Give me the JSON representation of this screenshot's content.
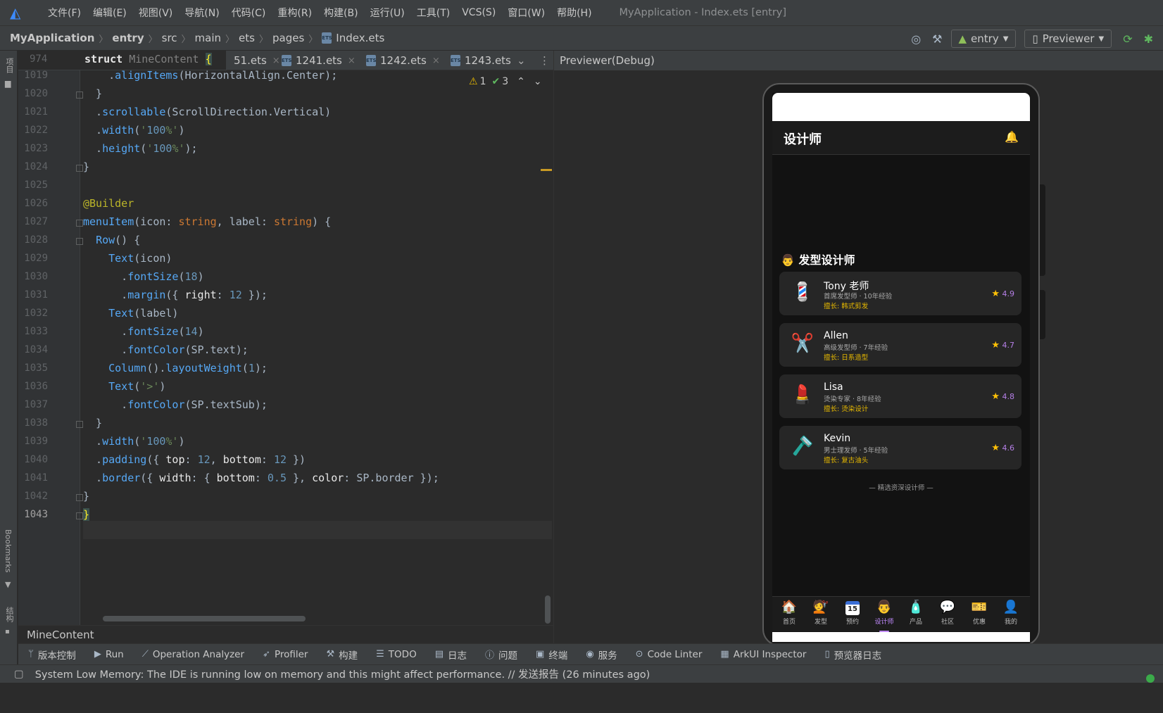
{
  "menubar": {
    "items": [
      "文件(F)",
      "编辑(E)",
      "视图(V)",
      "导航(N)",
      "代码(C)",
      "重构(R)",
      "构建(B)",
      "运行(U)",
      "工具(T)",
      "VCS(S)",
      "窗口(W)",
      "帮助(H)"
    ],
    "window_title": "MyApplication - Index.ets [entry]"
  },
  "navbar": {
    "crumbs": [
      "MyApplication",
      "entry",
      "src",
      "main",
      "ets",
      "pages"
    ],
    "file": "Index.ets",
    "run_config": "entry",
    "device": "Previewer"
  },
  "left_strip": {
    "project": "项目",
    "bookmarks": "Bookmarks",
    "structure": "结构"
  },
  "editor": {
    "sticky_line": "974",
    "sticky_code": "struct MineContent {",
    "tabs": [
      "51.ets",
      "1241.ets",
      "1242.ets",
      "1243.ets"
    ],
    "inspection": {
      "warnings": "1",
      "checks": "3"
    },
    "lines": [
      {
        "n": "1019",
        "txt": "    .alignItems(HorizontalAlign.Center);"
      },
      {
        "n": "1020",
        "txt": "  }"
      },
      {
        "n": "1021",
        "txt": "  .scrollable(ScrollDirection.Vertical)"
      },
      {
        "n": "1022",
        "txt": "  .width('100%')"
      },
      {
        "n": "1023",
        "txt": "  .height('100%');"
      },
      {
        "n": "1024",
        "txt": "}"
      },
      {
        "n": "1025",
        "txt": ""
      },
      {
        "n": "1026",
        "txt": "@Builder"
      },
      {
        "n": "1027",
        "txt": "menuItem(icon: string, label: string) {"
      },
      {
        "n": "1028",
        "txt": "  Row() {"
      },
      {
        "n": "1029",
        "txt": "    Text(icon)"
      },
      {
        "n": "1030",
        "txt": "      .fontSize(18)"
      },
      {
        "n": "1031",
        "txt": "      .margin({ right: 12 });"
      },
      {
        "n": "1032",
        "txt": "    Text(label)"
      },
      {
        "n": "1033",
        "txt": "      .fontSize(14)"
      },
      {
        "n": "1034",
        "txt": "      .fontColor(SP.text);"
      },
      {
        "n": "1035",
        "txt": "    Column().layoutWeight(1);"
      },
      {
        "n": "1036",
        "txt": "    Text('>')"
      },
      {
        "n": "1037",
        "txt": "      .fontColor(SP.textSub);"
      },
      {
        "n": "1038",
        "txt": "  }"
      },
      {
        "n": "1039",
        "txt": "  .width('100%')"
      },
      {
        "n": "1040",
        "txt": "  .padding({ top: 12, bottom: 12 })"
      },
      {
        "n": "1041",
        "txt": "  .border({ width: { bottom: 0.5 }, color: SP.border });"
      },
      {
        "n": "1042",
        "txt": "}"
      },
      {
        "n": "1043",
        "txt": "}"
      }
    ],
    "breadcrumb": "MineContent"
  },
  "preview": {
    "header": "Previewer(Debug)",
    "app": {
      "title": "设计师",
      "section": "发型设计师",
      "designers": [
        {
          "icon": "barber-pole",
          "name": "Tony 老师",
          "sub": "首席发型师 · 10年经验",
          "spec": "擅长: 韩式剪发",
          "rating": "4.9"
        },
        {
          "icon": "scissors",
          "name": "Allen",
          "sub": "高级发型师 · 7年经验",
          "spec": "擅长: 日系造型",
          "rating": "4.7"
        },
        {
          "icon": "lipstick",
          "name": "Lisa",
          "sub": "烫染专家 · 8年经验",
          "spec": "擅长: 烫染设计",
          "rating": "4.8"
        },
        {
          "icon": "razor",
          "name": "Kevin",
          "sub": "男士理发师 · 5年经验",
          "spec": "擅长: 复古油头",
          "rating": "4.6"
        }
      ],
      "footnote": "— 精选资深设计师 —",
      "tabs": [
        {
          "icon": "house-icon",
          "label": "首页"
        },
        {
          "icon": "stylist-icon",
          "label": "发型"
        },
        {
          "icon": "calendar-icon",
          "label": "预约"
        },
        {
          "icon": "designer-icon",
          "label": "设计师"
        },
        {
          "icon": "product-icon",
          "label": "产品"
        },
        {
          "icon": "chat-icon",
          "label": "社区"
        },
        {
          "icon": "ticket-icon",
          "label": "优惠"
        },
        {
          "icon": "user-icon",
          "label": "我的"
        }
      ],
      "calendar_day": "15",
      "accent_color": "#c28bff",
      "active_tab": "设计师"
    }
  },
  "toolwindows": [
    "版本控制",
    "Run",
    "Operation Analyzer",
    "Profiler",
    "构建",
    "TODO",
    "日志",
    "问题",
    "终端",
    "服务",
    "Code Linter",
    "ArkUI Inspector",
    "预览器日志"
  ],
  "status_message": "System Low Memory: The IDE is running low on memory and this might affect performance. // 发送报告 (26 minutes ago)"
}
